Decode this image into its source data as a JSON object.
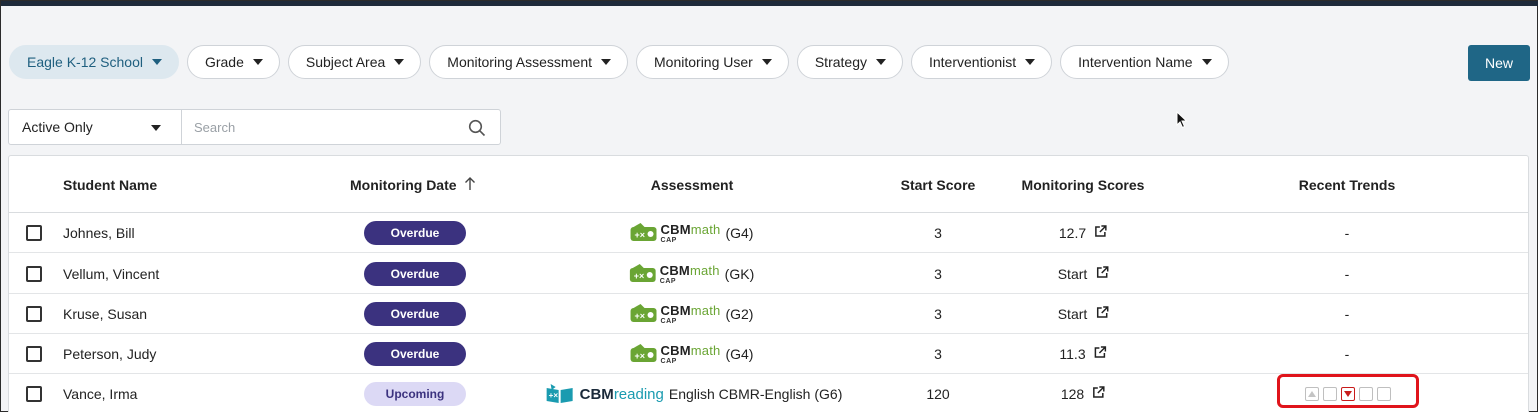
{
  "filters": {
    "items": [
      {
        "label": "Eagle K-12 School",
        "active": true
      },
      {
        "label": "Grade"
      },
      {
        "label": "Subject Area"
      },
      {
        "label": "Monitoring Assessment"
      },
      {
        "label": "Monitoring User"
      },
      {
        "label": "Strategy"
      },
      {
        "label": "Interventionist"
      },
      {
        "label": "Intervention Name"
      }
    ],
    "new_label": "New"
  },
  "search": {
    "status_value": "Active Only",
    "placeholder": "Search",
    "value": ""
  },
  "table": {
    "headers": {
      "student_name": "Student Name",
      "monitoring_date": "Monitoring Date",
      "assessment": "Assessment",
      "start_score": "Start Score",
      "monitoring_scores": "Monitoring Scores",
      "recent_trends": "Recent Trends"
    },
    "rows": [
      {
        "name": "Johnes, Bill",
        "status": "Overdue",
        "assessment_brand": "CBM",
        "assessment_sub": "math",
        "assessment_cap": "CAP",
        "grade": "(G4)",
        "start_score": "3",
        "monitoring_score": "12.7",
        "trend": "-"
      },
      {
        "name": "Vellum, Vincent",
        "status": "Overdue",
        "assessment_brand": "CBM",
        "assessment_sub": "math",
        "assessment_cap": "CAP",
        "grade": "(GK)",
        "start_score": "3",
        "monitoring_score": "Start",
        "trend": "-"
      },
      {
        "name": "Kruse, Susan",
        "status": "Overdue",
        "assessment_brand": "CBM",
        "assessment_sub": "math",
        "assessment_cap": "CAP",
        "grade": "(G2)",
        "start_score": "3",
        "monitoring_score": "Start",
        "trend": "-"
      },
      {
        "name": "Peterson, Judy",
        "status": "Overdue",
        "assessment_brand": "CBM",
        "assessment_sub": "math",
        "assessment_cap": "CAP",
        "grade": "(G4)",
        "start_score": "3",
        "monitoring_score": "11.3",
        "trend": "-"
      },
      {
        "name": "Vance, Irma",
        "status": "Upcoming",
        "assessment_brand": "CBM",
        "assessment_sub": "reading",
        "assessment_detail": "English CBMR-English (G6)",
        "start_score": "120",
        "monitoring_score": "128"
      }
    ]
  },
  "colors": {
    "accent": "#1f6686",
    "overdue": "#3b327f",
    "upcoming": "#dcd9f5",
    "highlight": "#e0141b",
    "math_green": "#6aa534",
    "reading_teal": "#1a9bb0"
  }
}
